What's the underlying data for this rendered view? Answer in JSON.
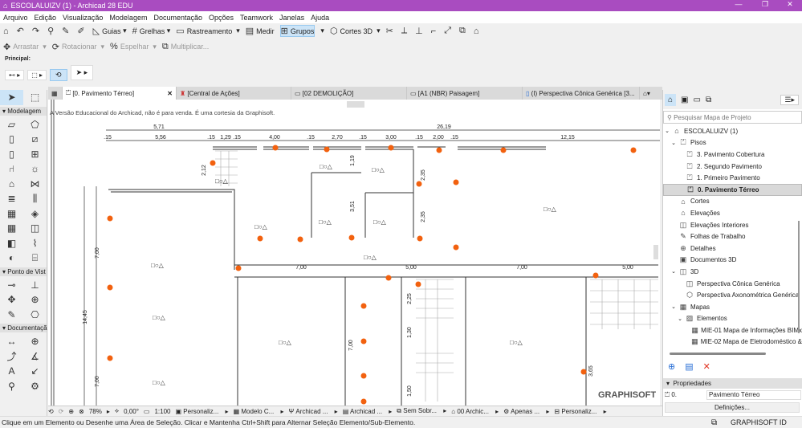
{
  "window": {
    "title": "ESCOLALUIZV (1) - Archicad 28 EDU",
    "minimize": "—",
    "maximize": "❐",
    "close": "✕"
  },
  "menu": [
    "Arquivo",
    "Edição",
    "Visualização",
    "Modelagem",
    "Documentação",
    "Opções",
    "Teamwork",
    "Janelas",
    "Ajuda"
  ],
  "toolbar": {
    "guias": "Guias",
    "grelhas": "Grelhas",
    "rastreamento": "Rastreamento",
    "medir": "Medir",
    "grupos": "Grupos",
    "cortes3d": "Cortes 3D"
  },
  "edit_toolbar": {
    "arrastar": "Arrastar",
    "rotacionar": "Rotacionar",
    "espelhar": "Espelhar",
    "multiplicar": "Multiplicar..."
  },
  "principal_label": "Principal:",
  "tabs": [
    "[0. Pavimento Térreo]",
    "[Central de Ações]",
    "[02 DEMOLIÇÃO]",
    "[A1 (NBR) Paisagem]",
    "(I) Perspectiva Cônica Genérica [3..."
  ],
  "toolbox": {
    "groups": [
      "Modelagem",
      "Ponto de Vist",
      "Documentaçã"
    ]
  },
  "canvas": {
    "watermark_note": "A Versão Educacional do Archicad, não é para venda. É uma cortesia da Graphisoft.",
    "logo": "GRAPHISOFT",
    "dims": {
      "d1": "5,71",
      "d2": "26,19",
      "r1": ".15",
      "r2": "5,56",
      "r3": ".15",
      "r4": "1,29",
      "r5": ".15",
      "r6": "4,00",
      "r7": ".15",
      "r8": "2,70",
      "r9": ".15",
      "r10": "3,00",
      "r11": ".15",
      "r12": "2,00",
      "r13": ".15",
      "r14": "12,15",
      "v1": "2,12",
      "v2": "1,19",
      "v3": "3,51",
      "v4": "2,35",
      "v5": "2,35",
      "v6": "7,00",
      "v7": "14,45",
      "v8": "7,00",
      "h1": "7,00",
      "h2": "5,00",
      "h3": "7,00",
      "h4": "5,00",
      "v9": "2,25",
      "v10": "1,30",
      "v11": "1,50",
      "v12": "7,00",
      "v13": "3,65"
    },
    "zone_marker": "□○△"
  },
  "navigator": {
    "search_placeholder": "Pesquisar Mapa de Projeto",
    "items": [
      "ESCOLALUIZV (1)",
      "Pisos",
      "3. Pavimento Cobertura",
      "2. Segundo Pavimento",
      "1. Primeiro Pavimento",
      "0. Pavimento Térreo",
      "Cortes",
      "Elevações",
      "Elevações Interiores",
      "Folhas de Trabalho",
      "Detalhes",
      "Documentos 3D",
      "3D",
      "Perspectiva Cônica Genérica",
      "Perspectiva Axonométrica Genérica",
      "Mapas",
      "Elementos",
      "MIE-01 Mapa de Informações BIMx",
      "MIE-02 Mapa de Eletrodoméstico &"
    ]
  },
  "properties": {
    "header": "Propriedades",
    "id": "0.",
    "name": "Pavimento Térreo",
    "button": "Definições..."
  },
  "zoombar": {
    "zoom": "78%",
    "angle": "0,00°",
    "scale": "1:100",
    "items": [
      "Personaliz...",
      "Modelo C...",
      "Archicad ...",
      "Archicad ...",
      "Sem Sobr...",
      "00 Archic...",
      "Apenas ...",
      "Personaliz..."
    ]
  },
  "status": {
    "message": "Clique em um Elemento ou Desenhe uma Área de Seleção. Clicar e Mantenha Ctrl+Shift para Alternar Seleção Elemento/Sub-Elemento.",
    "graphisoft_id": "GRAPHISOFT ID"
  },
  "colors": {
    "titlebar": "#a94cc0",
    "marker": "#f2610f"
  }
}
